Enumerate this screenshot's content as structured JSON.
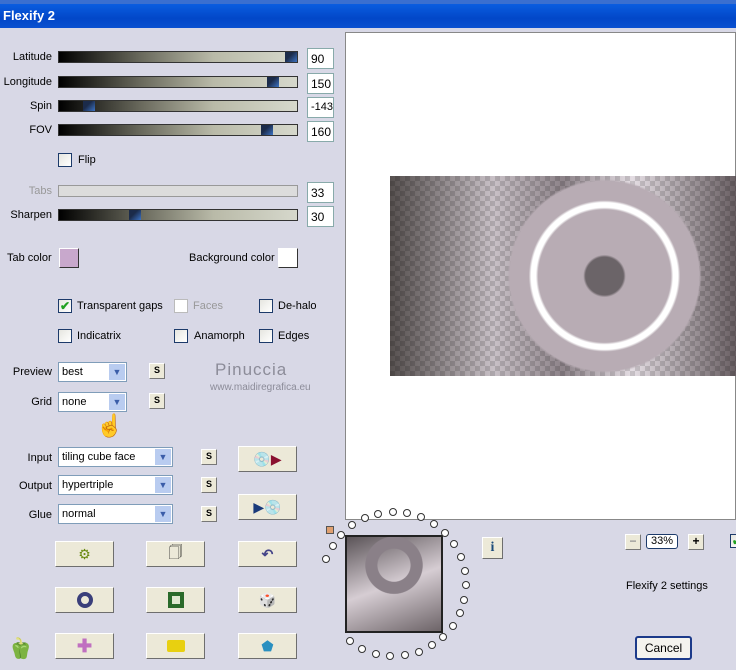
{
  "window": {
    "title": "Flexify 2"
  },
  "sliders": [
    {
      "label": "Latitude",
      "value": "90",
      "fraction": 0.97
    },
    {
      "label": "Longitude",
      "value": "150",
      "fraction": 0.9
    },
    {
      "label": "Spin",
      "value": "-143",
      "fraction": 0.11
    },
    {
      "label": "FOV",
      "value": "160",
      "fraction": 0.87
    },
    {
      "label": "Tabs",
      "value": "33",
      "fraction": null,
      "disabled": true
    },
    {
      "label": "Sharpen",
      "value": "30",
      "fraction": 0.31
    }
  ],
  "flip": {
    "label": "Flip",
    "checked": false
  },
  "colors": {
    "tab_label": "Tab color",
    "tab_color": "#c8a8cc",
    "bg_label": "Background color",
    "bg_color": "#ffffff",
    "title_bar": "#0a5de0"
  },
  "options": [
    {
      "label": "Transparent gaps",
      "checked": true
    },
    {
      "label": "Faces",
      "checked": false,
      "disabled": true
    },
    {
      "label": "De-halo",
      "checked": false
    },
    {
      "label": "Indicatrix",
      "checked": false
    },
    {
      "label": "Anamorph",
      "checked": false
    },
    {
      "label": "Edges",
      "checked": false
    }
  ],
  "selects": {
    "preview": {
      "label": "Preview",
      "value": "best"
    },
    "grid": {
      "label": "Grid",
      "value": "none"
    },
    "input": {
      "label": "Input",
      "value": "tiling cube face"
    },
    "output": {
      "label": "Output",
      "value": "hypertriple"
    },
    "glue": {
      "label": "Glue",
      "value": "normal"
    }
  },
  "s_label": "S",
  "watermark": {
    "name": "Pinuccia",
    "url": "www.maidiregrafica.eu"
  },
  "zoom": {
    "minus": "−",
    "value": "33%",
    "plus": "+"
  },
  "info": "i",
  "settings_label": "Flexify 2 settings",
  "cancel": "Cancel"
}
